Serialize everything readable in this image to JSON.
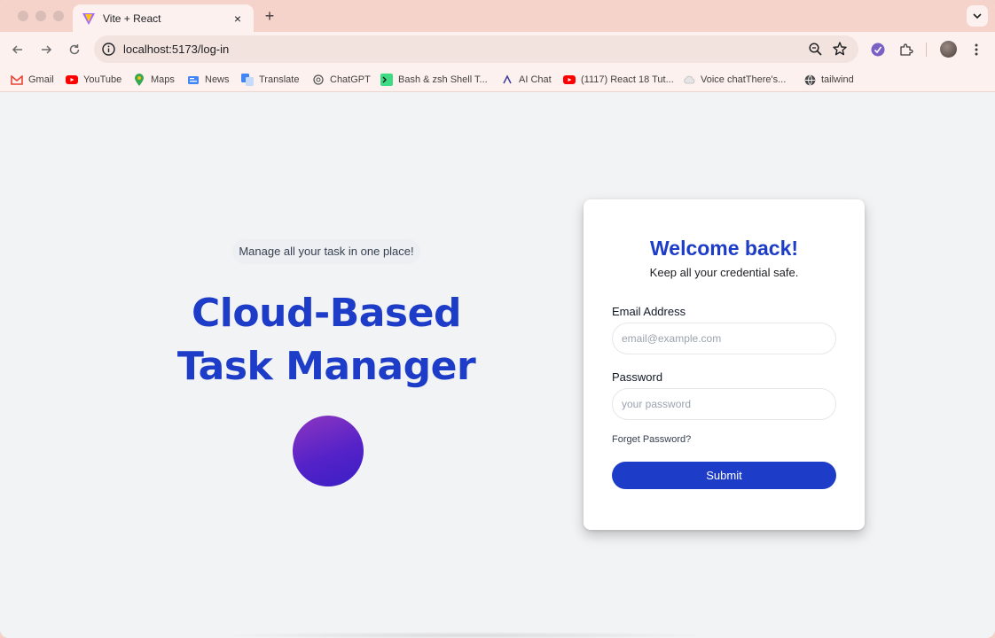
{
  "browser": {
    "tab": {
      "title": "Vite + React",
      "close": "×"
    },
    "new_tab": "+",
    "address": {
      "url": "localhost:5173/log-in"
    },
    "bookmarks": [
      {
        "label": "Gmail",
        "icon": "gmail-icon"
      },
      {
        "label": "YouTube",
        "icon": "youtube-icon"
      },
      {
        "label": "Maps",
        "icon": "maps-icon"
      },
      {
        "label": "News",
        "icon": "news-icon"
      },
      {
        "label": "Translate",
        "icon": "translate-icon"
      },
      {
        "label": "ChatGPT",
        "icon": "chatgpt-icon"
      },
      {
        "label": "Bash & zsh Shell T...",
        "icon": "shell-icon"
      },
      {
        "label": "AI Chat",
        "icon": "ai-chat-icon"
      },
      {
        "label": "(1117) React 18 Tut...",
        "icon": "youtube-icon"
      },
      {
        "label": "Voice chatThere's...",
        "icon": "cloud-icon"
      },
      {
        "label": "tailwind",
        "icon": "globe-icon"
      }
    ]
  },
  "hero": {
    "tagline": "Manage all your task in one place!",
    "title_line1": "Cloud-Based",
    "title_line2": "Task Manager"
  },
  "login": {
    "title": "Welcome back!",
    "subtitle": "Keep all your credential safe.",
    "email_label": "Email Address",
    "email_placeholder": "email@example.com",
    "password_label": "Password",
    "password_placeholder": "your password",
    "forgot": "Forget Password?",
    "submit": "Submit"
  },
  "colors": {
    "brand": "#1d3cc8",
    "chrome": "#f5d3cb"
  }
}
